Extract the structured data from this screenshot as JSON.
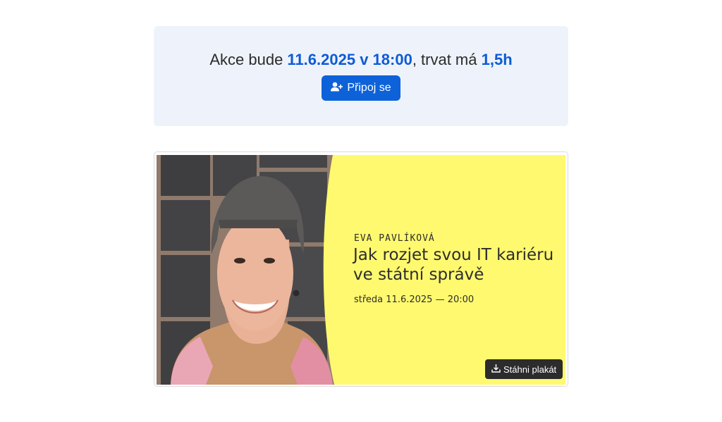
{
  "event": {
    "prefix": "Akce bude ",
    "datetime": "11.6.2025 v 18:00",
    "middle": ", trvat má ",
    "duration": "1,5h",
    "join_label": "Připoj se",
    "join_icon": "user-plus-icon"
  },
  "poster": {
    "speaker": "EVA PAVLÍKOVÁ",
    "title": "Jak rozjet svou IT kariéru ve státní správě",
    "date": "středa 11.6.2025 — 20:00",
    "download_label": "Stáhni plakát",
    "download_icon": "download-icon",
    "background_color": "#fff96f"
  },
  "colors": {
    "accent": "#0d5bd7",
    "button": "#0d62d9",
    "panel": "#eef3fb"
  }
}
